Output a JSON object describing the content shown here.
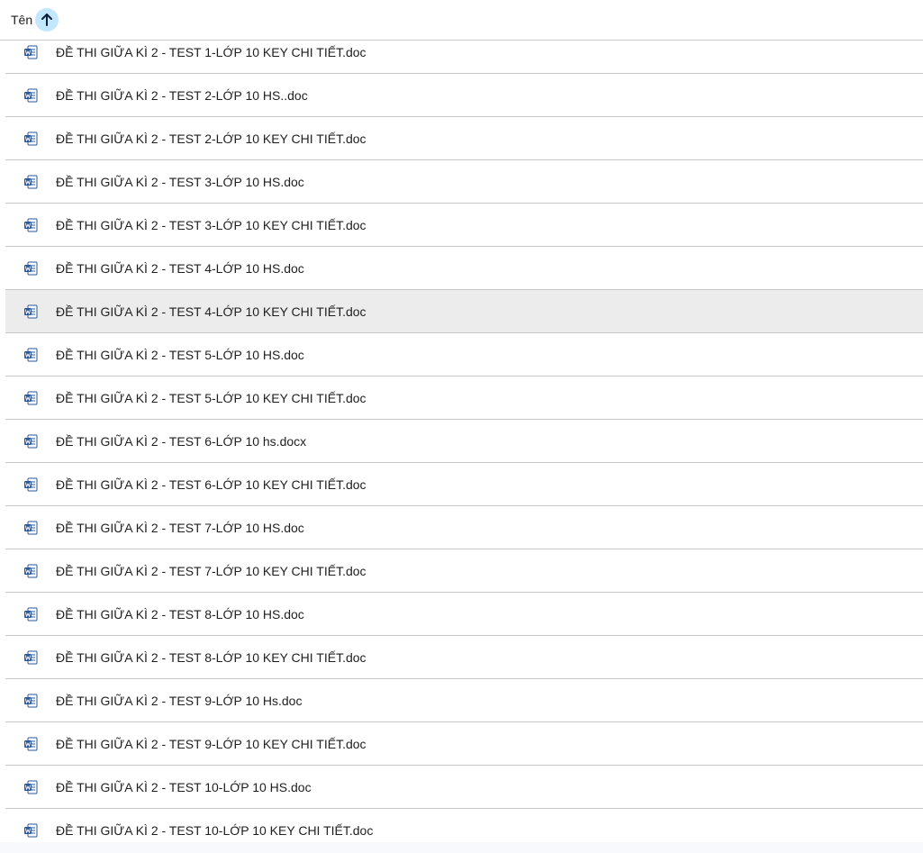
{
  "header": {
    "label": "Tên",
    "sort_icon": "arrow-up-icon",
    "sort_bg_color": "#c2e7ff"
  },
  "file_icon": "word-doc-icon",
  "file_icon_color": "#2b579a",
  "selected_index": 6,
  "files": [
    {
      "name": "ĐỀ THI GIỮA KÌ 2 - TEST 1-LỚP 10 KEY CHI TIẾT.doc"
    },
    {
      "name": "ĐỀ THI GIỮA KÌ 2 - TEST 2-LỚP 10 HS..doc"
    },
    {
      "name": "ĐỀ THI GIỮA KÌ 2 - TEST 2-LỚP 10 KEY CHI TIẾT.doc"
    },
    {
      "name": "ĐỀ THI GIỮA KÌ 2 - TEST 3-LỚP 10 HS.doc"
    },
    {
      "name": "ĐỀ THI GIỮA KÌ 2 - TEST 3-LỚP 10 KEY CHI TIẾT.doc"
    },
    {
      "name": "ĐỀ THI GIỮA KÌ 2 - TEST 4-LỚP 10 HS.doc"
    },
    {
      "name": "ĐỀ THI GIỮA KÌ 2 - TEST 4-LỚP 10 KEY CHI TIẾT.doc"
    },
    {
      "name": "ĐỀ THI GIỮA KÌ 2 - TEST 5-LỚP 10 HS.doc"
    },
    {
      "name": "ĐỀ THI GIỮA KÌ 2 - TEST 5-LỚP 10 KEY CHI TIẾT.doc"
    },
    {
      "name": "ĐỀ THI GIỮA KÌ 2 - TEST 6-LỚP 10 hs.docx"
    },
    {
      "name": "ĐỀ THI GIỮA KÌ 2 - TEST 6-LỚP 10 KEY CHI TIẾT.doc"
    },
    {
      "name": "ĐỀ THI GIỮA KÌ 2 - TEST 7-LỚP 10 HS.doc"
    },
    {
      "name": "ĐỀ THI GIỮA KÌ 2 - TEST 7-LỚP 10 KEY CHI TIẾT.doc"
    },
    {
      "name": "ĐỀ THI GIỮA KÌ 2 - TEST 8-LỚP 10 HS.doc"
    },
    {
      "name": "ĐỀ THI GIỮA KÌ 2 - TEST 8-LỚP 10 KEY CHI TIẾT.doc"
    },
    {
      "name": "ĐỀ THI GIỮA KÌ 2 - TEST 9-LỚP 10 Hs.doc"
    },
    {
      "name": "ĐỀ THI GIỮA KÌ 2 - TEST 9-LỚP 10 KEY CHI TIẾT.doc"
    },
    {
      "name": "ĐỀ THI GIỮA KÌ 2 - TEST 10-LỚP 10 HS.doc"
    },
    {
      "name": "ĐỀ THI GIỮA KÌ 2 - TEST 10-LỚP 10 KEY CHI TIẾT.doc"
    }
  ]
}
